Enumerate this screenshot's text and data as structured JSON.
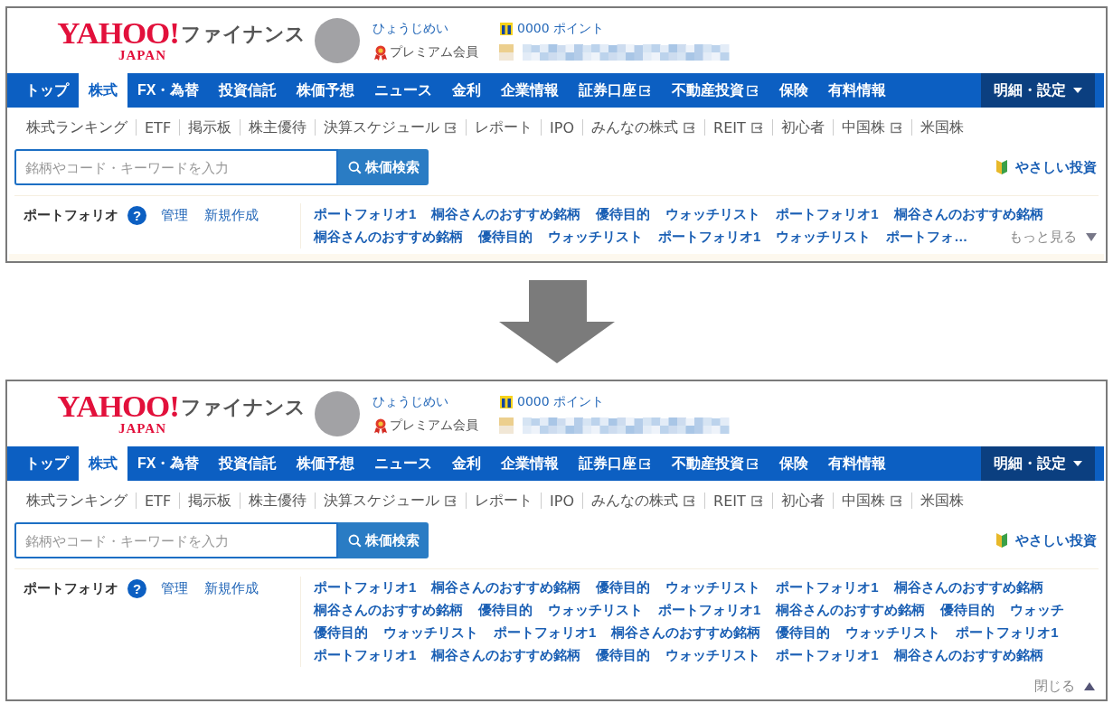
{
  "panels": [
    {
      "logo": {
        "wordmark": "YAHOO!",
        "sub": "JAPAN",
        "service": "ファイナンス"
      },
      "user": {
        "name": "ひょうじめい",
        "membership": "プレミアム会員",
        "points": "0000 ポイント"
      },
      "nav": [
        {
          "label": "トップ",
          "selected": false,
          "external": false
        },
        {
          "label": "株式",
          "selected": true,
          "external": false
        },
        {
          "label": "FX・為替",
          "selected": false,
          "external": false
        },
        {
          "label": "投資信託",
          "selected": false,
          "external": false
        },
        {
          "label": "株価予想",
          "selected": false,
          "external": false
        },
        {
          "label": "ニュース",
          "selected": false,
          "external": false
        },
        {
          "label": "金利",
          "selected": false,
          "external": false
        },
        {
          "label": "企業情報",
          "selected": false,
          "external": false
        },
        {
          "label": "証券口座",
          "selected": false,
          "external": true
        },
        {
          "label": "不動産投資",
          "selected": false,
          "external": true
        },
        {
          "label": "保険",
          "selected": false,
          "external": false
        },
        {
          "label": "有料情報",
          "selected": false,
          "external": false
        }
      ],
      "menu": {
        "label": "明細・設定"
      },
      "subnav": [
        {
          "label": "株式ランキング",
          "external": false
        },
        {
          "label": "ETF",
          "external": false
        },
        {
          "label": "掲示板",
          "external": false
        },
        {
          "label": "株主優待",
          "external": false
        },
        {
          "label": "決算スケジュール",
          "external": true
        },
        {
          "label": "レポート",
          "external": false
        },
        {
          "label": "IPO",
          "external": false
        },
        {
          "label": "みんなの株式",
          "external": true
        },
        {
          "label": "REIT",
          "external": true
        },
        {
          "label": "初心者",
          "external": false
        },
        {
          "label": "中国株",
          "external": true
        },
        {
          "label": "米国株",
          "external": false
        }
      ],
      "search": {
        "placeholder": "銘柄やコード・キーワードを入力",
        "button": "株価検索"
      },
      "easy_link": "やさしい投資",
      "portfolio": {
        "title": "ポートフォリオ",
        "help": "?",
        "actions": [
          "管理",
          "新規作成"
        ],
        "rows": [
          [
            "ポートフォリオ1",
            "桐谷さんのおすすめ銘柄",
            "優待目的",
            "ウォッチリスト",
            "ポートフォリオ1",
            "桐谷さんのおすすめ銘柄"
          ],
          [
            "桐谷さんのおすすめ銘柄",
            "優待目的",
            "ウォッチリスト",
            "ポートフォリオ1",
            "ウォッチリスト",
            "ポートフォ…"
          ]
        ],
        "expanded": false,
        "toggle": "もっと見る"
      }
    },
    {
      "logo": {
        "wordmark": "YAHOO!",
        "sub": "JAPAN",
        "service": "ファイナンス"
      },
      "user": {
        "name": "ひょうじめい",
        "membership": "プレミアム会員",
        "points": "0000 ポイント"
      },
      "nav": [
        {
          "label": "トップ",
          "selected": false,
          "external": false
        },
        {
          "label": "株式",
          "selected": true,
          "external": false
        },
        {
          "label": "FX・為替",
          "selected": false,
          "external": false
        },
        {
          "label": "投資信託",
          "selected": false,
          "external": false
        },
        {
          "label": "株価予想",
          "selected": false,
          "external": false
        },
        {
          "label": "ニュース",
          "selected": false,
          "external": false
        },
        {
          "label": "金利",
          "selected": false,
          "external": false
        },
        {
          "label": "企業情報",
          "selected": false,
          "external": false
        },
        {
          "label": "証券口座",
          "selected": false,
          "external": true
        },
        {
          "label": "不動産投資",
          "selected": false,
          "external": true
        },
        {
          "label": "保険",
          "selected": false,
          "external": false
        },
        {
          "label": "有料情報",
          "selected": false,
          "external": false
        }
      ],
      "menu": {
        "label": "明細・設定"
      },
      "subnav": [
        {
          "label": "株式ランキング",
          "external": false
        },
        {
          "label": "ETF",
          "external": false
        },
        {
          "label": "掲示板",
          "external": false
        },
        {
          "label": "株主優待",
          "external": false
        },
        {
          "label": "決算スケジュール",
          "external": true
        },
        {
          "label": "レポート",
          "external": false
        },
        {
          "label": "IPO",
          "external": false
        },
        {
          "label": "みんなの株式",
          "external": true
        },
        {
          "label": "REIT",
          "external": true
        },
        {
          "label": "初心者",
          "external": false
        },
        {
          "label": "中国株",
          "external": true
        },
        {
          "label": "米国株",
          "external": false
        }
      ],
      "search": {
        "placeholder": "銘柄やコード・キーワードを入力",
        "button": "株価検索"
      },
      "easy_link": "やさしい投資",
      "portfolio": {
        "title": "ポートフォリオ",
        "help": "?",
        "actions": [
          "管理",
          "新規作成"
        ],
        "rows": [
          [
            "ポートフォリオ1",
            "桐谷さんのおすすめ銘柄",
            "優待目的",
            "ウォッチリスト",
            "ポートフォリオ1",
            "桐谷さんのおすすめ銘柄"
          ],
          [
            "桐谷さんのおすすめ銘柄",
            "優待目的",
            "ウォッチリスト",
            "ポートフォリオ1",
            "桐谷さんのおすすめ銘柄",
            "優待目的",
            "ウォッチ"
          ],
          [
            "優待目的",
            "ウォッチリスト",
            "ポートフォリオ1",
            "桐谷さんのおすすめ銘柄",
            "優待目的",
            "ウォッチリスト",
            "ポートフォリオ1"
          ],
          [
            "ポートフォリオ1",
            "桐谷さんのおすすめ銘柄",
            "優待目的",
            "ウォッチリスト",
            "ポートフォリオ1",
            "桐谷さんのおすすめ銘柄"
          ]
        ],
        "expanded": true,
        "toggle": "閉じる"
      }
    }
  ]
}
